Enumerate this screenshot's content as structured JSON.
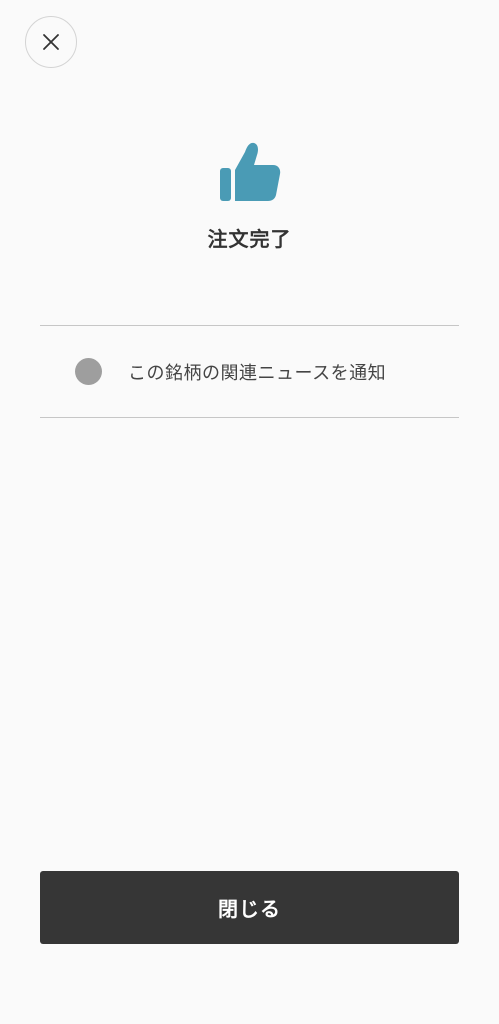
{
  "header": {
    "close_icon": "close-icon"
  },
  "result": {
    "icon": "thumbs-up-icon",
    "icon_color": "#4a9bb5",
    "title": "注文完了"
  },
  "notification": {
    "label": "この銘柄の関連ニュースを通知",
    "enabled": false,
    "toggle_color": "#9e9e9e"
  },
  "footer": {
    "close_label": "閉じる",
    "button_color": "#363636"
  }
}
